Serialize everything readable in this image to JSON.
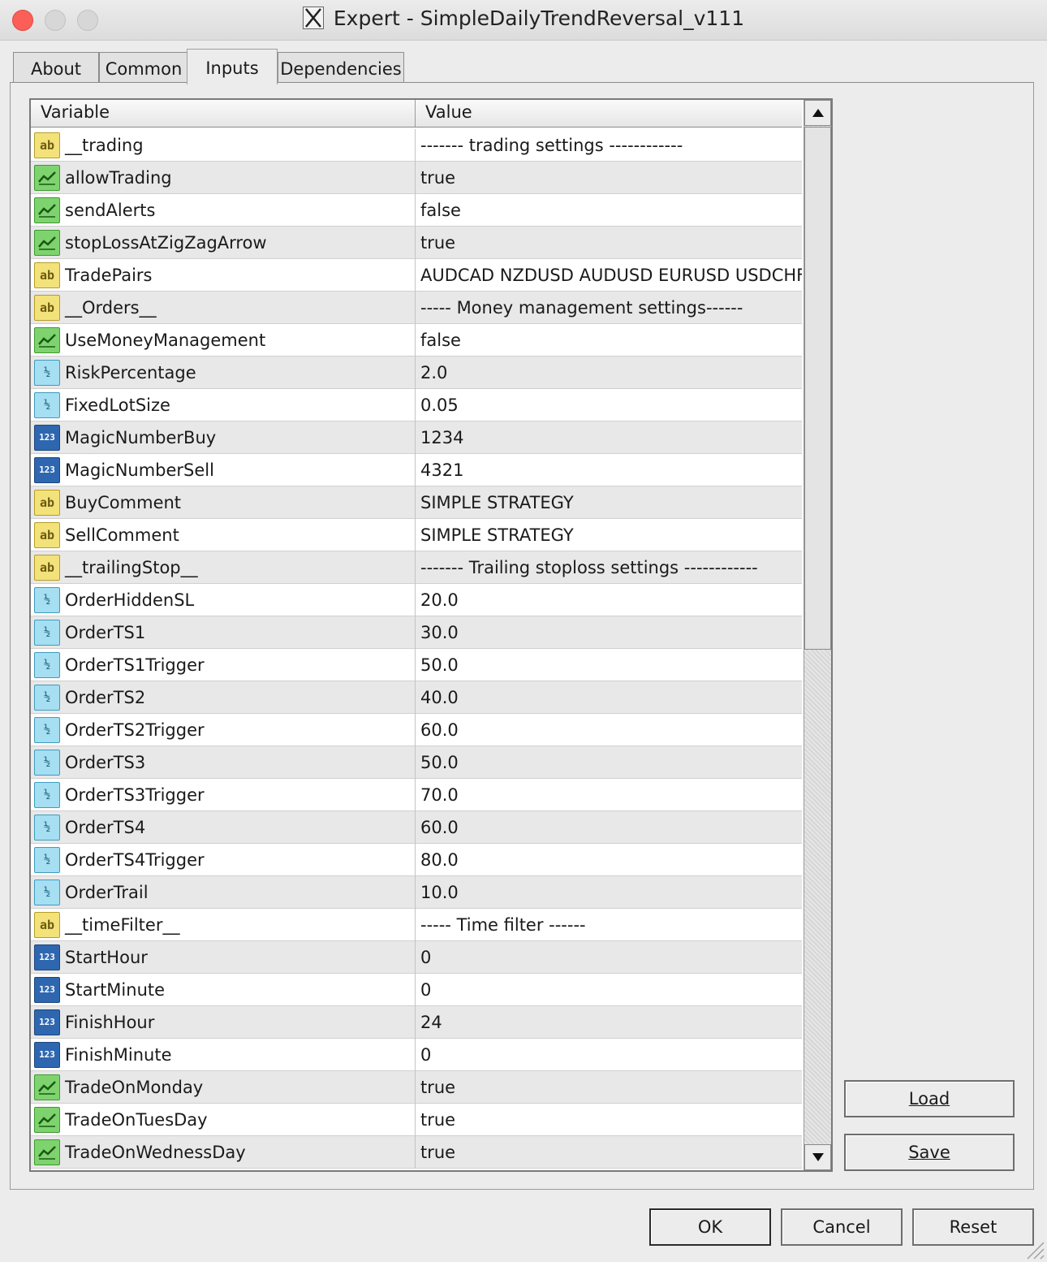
{
  "window": {
    "title": "Expert - SimpleDailyTrendReversal_v111"
  },
  "tabs": [
    "About",
    "Common",
    "Inputs",
    "Dependencies"
  ],
  "active_tab": "Inputs",
  "grid": {
    "headers": {
      "variable": "Variable",
      "value": "Value"
    },
    "rows": [
      {
        "type": "ab",
        "name": "__trading",
        "value": " ------- trading settings ------------"
      },
      {
        "type": "bool",
        "name": "allowTrading",
        "value": "true"
      },
      {
        "type": "bool",
        "name": "sendAlerts",
        "value": "false"
      },
      {
        "type": "bool",
        "name": "stopLossAtZigZagArrow",
        "value": "true"
      },
      {
        "type": "ab",
        "name": "TradePairs",
        "value": "AUDCAD NZDUSD AUDUSD EURUSD USDCHF ..."
      },
      {
        "type": "ab",
        "name": "__Orders__",
        "value": "----- Money management settings------"
      },
      {
        "type": "bool",
        "name": "UseMoneyManagement",
        "value": "false"
      },
      {
        "type": "dbl",
        "name": "RiskPercentage",
        "value": "2.0"
      },
      {
        "type": "dbl",
        "name": "FixedLotSize",
        "value": "0.05"
      },
      {
        "type": "int",
        "name": "MagicNumberBuy",
        "value": "1234"
      },
      {
        "type": "int",
        "name": "MagicNumberSell",
        "value": "4321"
      },
      {
        "type": "ab",
        "name": "BuyComment",
        "value": "SIMPLE STRATEGY"
      },
      {
        "type": "ab",
        "name": "SellComment",
        "value": "SIMPLE STRATEGY"
      },
      {
        "type": "ab",
        "name": "__trailingStop__",
        "value": " ------- Trailing stoploss settings ------------"
      },
      {
        "type": "dbl",
        "name": "OrderHiddenSL",
        "value": "20.0"
      },
      {
        "type": "dbl",
        "name": "OrderTS1",
        "value": "30.0"
      },
      {
        "type": "dbl",
        "name": "OrderTS1Trigger",
        "value": "50.0"
      },
      {
        "type": "dbl",
        "name": "OrderTS2",
        "value": "40.0"
      },
      {
        "type": "dbl",
        "name": "OrderTS2Trigger",
        "value": "60.0"
      },
      {
        "type": "dbl",
        "name": "OrderTS3",
        "value": "50.0"
      },
      {
        "type": "dbl",
        "name": "OrderTS3Trigger",
        "value": "70.0"
      },
      {
        "type": "dbl",
        "name": "OrderTS4",
        "value": "60.0"
      },
      {
        "type": "dbl",
        "name": "OrderTS4Trigger",
        "value": "80.0"
      },
      {
        "type": "dbl",
        "name": "OrderTrail",
        "value": "10.0"
      },
      {
        "type": "ab",
        "name": "__timeFilter__",
        "value": "----- Time filter ------"
      },
      {
        "type": "int",
        "name": "StartHour",
        "value": "0"
      },
      {
        "type": "int",
        "name": "StartMinute",
        "value": "0"
      },
      {
        "type": "int",
        "name": "FinishHour",
        "value": "24"
      },
      {
        "type": "int",
        "name": "FinishMinute",
        "value": "0"
      },
      {
        "type": "bool",
        "name": "TradeOnMonday",
        "value": "true"
      },
      {
        "type": "bool",
        "name": "TradeOnTuesDay",
        "value": "true"
      },
      {
        "type": "bool",
        "name": "TradeOnWednessDay",
        "value": "true"
      }
    ]
  },
  "icons": {
    "ab": "string-type-icon",
    "bool": "bool-type-icon",
    "dbl": "double-type-icon",
    "int": "integer-type-icon"
  },
  "icon_text": {
    "ab": "ab",
    "dbl": "½",
    "int": "123"
  },
  "buttons": {
    "load": "Load",
    "save": "Save",
    "ok": "OK",
    "cancel": "Cancel",
    "reset": "Reset"
  }
}
